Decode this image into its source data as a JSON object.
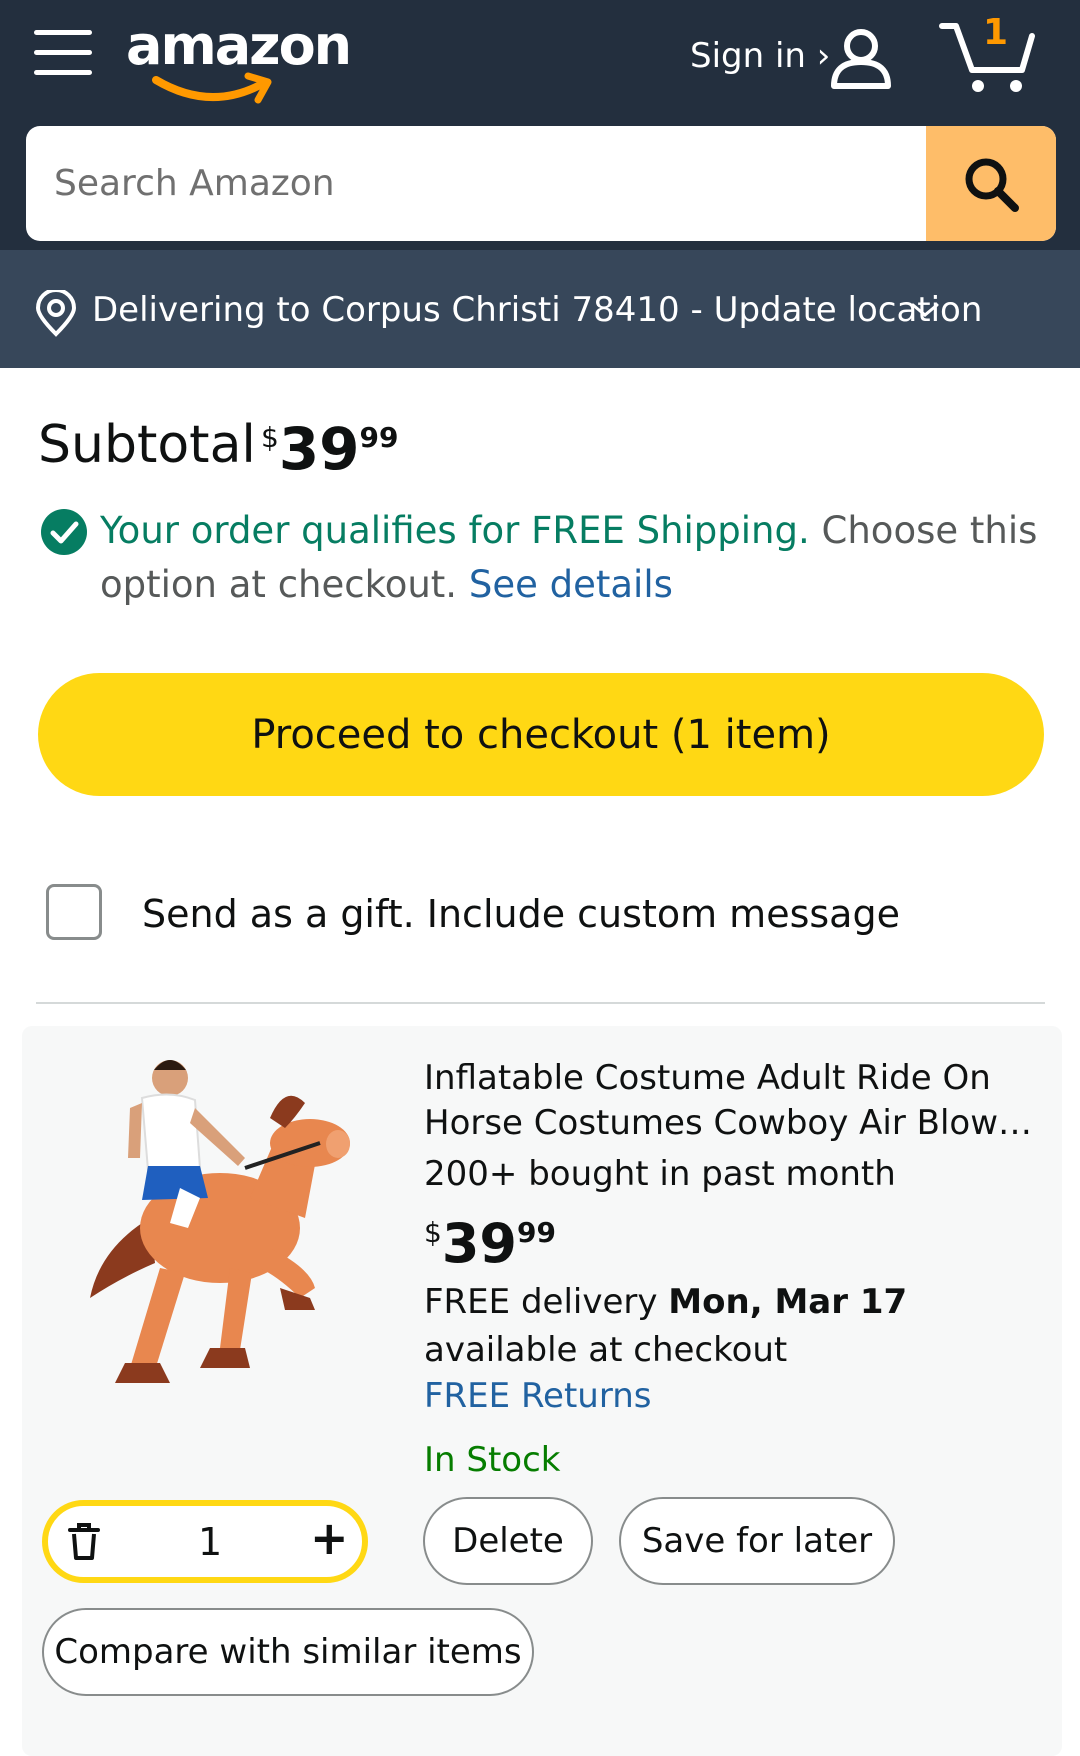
{
  "header": {
    "logo_text": "amazon",
    "signin_label": "Sign in ›",
    "cart_count": "1",
    "menu_icon": "hamburger-menu-icon",
    "user_icon": "user-icon",
    "cart_icon": "cart-icon"
  },
  "search": {
    "placeholder": "Search Amazon",
    "value": "",
    "button_icon": "search-icon"
  },
  "location": {
    "text": "Delivering to Corpus Christi 78410 - Update location",
    "icon": "location-pin-icon"
  },
  "subtotal": {
    "label": "Subtotal",
    "currency": "$",
    "whole": "39",
    "fraction": "99"
  },
  "shipping": {
    "qualifies_text": "Your order qualifies for FREE Shipping.",
    "rest_text": " Choose this option at checkout. ",
    "details_link": "See details"
  },
  "checkout": {
    "label": "Proceed to checkout (1 item)"
  },
  "gift": {
    "label": "Send as a gift. Include custom message",
    "checked": false
  },
  "item": {
    "title": "Inflatable Costume Adult Ride On Horse Costumes Cowboy Air Blow Up Costume",
    "bought": "200+ bought in past month",
    "price_currency": "$",
    "price_whole": "39",
    "price_fraction": "99",
    "delivery_prefix": "FREE delivery ",
    "delivery_date": "Mon, Mar 17",
    "delivery_suffix": " available at checkout",
    "returns": "FREE Returns",
    "stock": "In Stock",
    "quantity": "1",
    "delete_label": "Delete",
    "save_label": "Save for later",
    "compare_label": "Compare with similar items"
  },
  "colors": {
    "header_bg": "#232f3e",
    "location_bg": "#37475a",
    "search_button": "#febd69",
    "checkout_button": "#ffd814",
    "success_green": "#067d62",
    "link_blue": "#2162a1",
    "stock_green": "#067d00",
    "brand_orange": "#ff9900"
  }
}
